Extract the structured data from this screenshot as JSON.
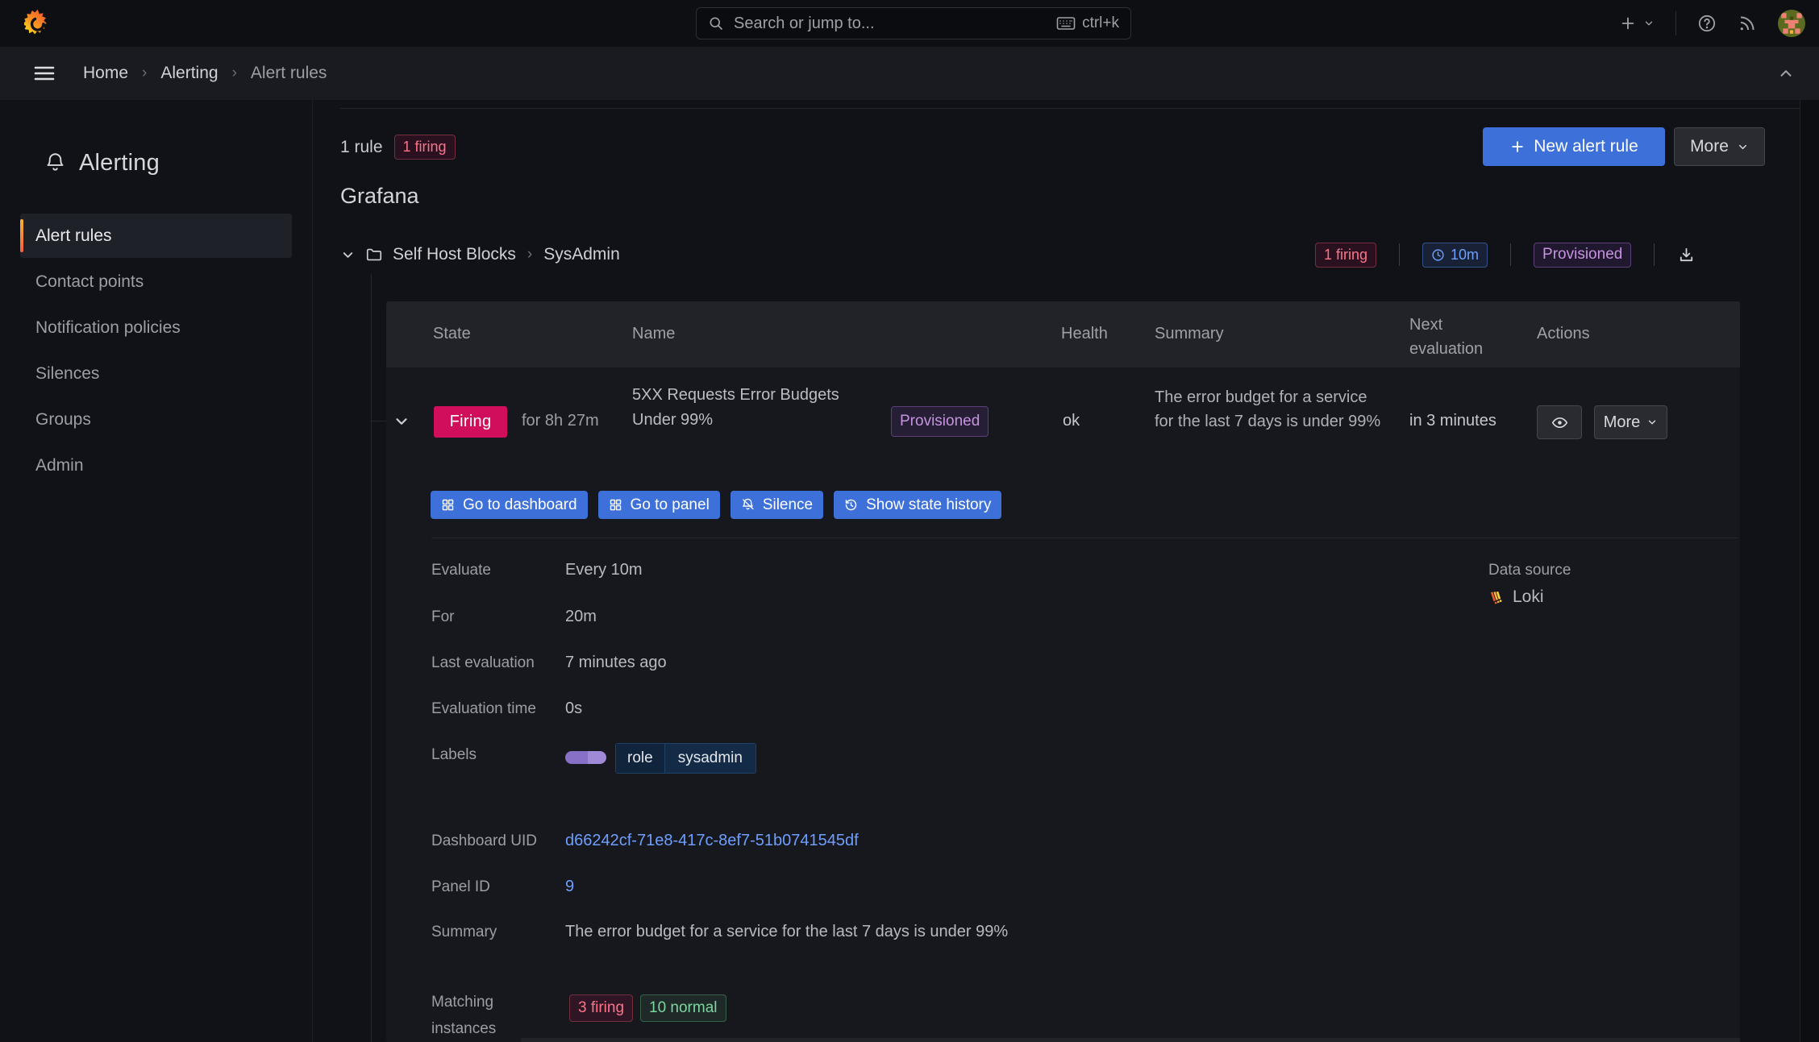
{
  "topnav": {
    "search_placeholder": "Search or jump to...",
    "shortcut": "ctrl+k"
  },
  "breadcrumb": {
    "items": [
      "Home",
      "Alerting",
      "Alert rules"
    ]
  },
  "sidebar": {
    "title": "Alerting",
    "items": [
      {
        "label": "Alert rules",
        "active": true
      },
      {
        "label": "Contact points",
        "active": false
      },
      {
        "label": "Notification policies",
        "active": false
      },
      {
        "label": "Silences",
        "active": false
      },
      {
        "label": "Groups",
        "active": false
      },
      {
        "label": "Admin",
        "active": false
      }
    ]
  },
  "toolbar": {
    "rule_count": "1 rule",
    "firing_badge": "1 firing",
    "new_rule_label": "New alert rule",
    "more_label": "More"
  },
  "section": {
    "namespace": "Grafana"
  },
  "group": {
    "folder": "Self Host Blocks",
    "name": "SysAdmin",
    "firing_badge": "1 firing",
    "interval": "10m",
    "provisioned_label": "Provisioned"
  },
  "table": {
    "headers": {
      "state": "State",
      "name": "Name",
      "health": "Health",
      "summary": "Summary",
      "next_evaluation": "Next evaluation",
      "actions": "Actions"
    },
    "row": {
      "state": "Firing",
      "duration": "for 8h 27m",
      "name": "5XX Requests Error Budgets Under 99%",
      "provisioned_label": "Provisioned",
      "health": "ok",
      "summary": "The error budget for a service for the last 7 days is under 99%",
      "next_evaluation": "in 3 minutes",
      "more_label": "More"
    }
  },
  "row_actions": {
    "dashboard": "Go to dashboard",
    "panel": "Go to panel",
    "silence": "Silence",
    "history": "Show state history"
  },
  "details": {
    "rows": [
      {
        "label": "Evaluate",
        "value": "Every 10m"
      },
      {
        "label": "For",
        "value": "20m"
      },
      {
        "label": "Last evaluation",
        "value": "7 minutes ago"
      },
      {
        "label": "Evaluation time",
        "value": "0s"
      },
      {
        "label": "Labels",
        "value": ""
      }
    ],
    "label_chip": {
      "key": "role",
      "value": "sysadmin"
    },
    "datasource": {
      "label": "Data source",
      "name": "Loki"
    },
    "meta": [
      {
        "label": "Dashboard UID",
        "value": "d66242cf-71e8-417c-8ef7-51b0741545df"
      },
      {
        "label": "Panel ID",
        "value": "9"
      },
      {
        "label": "Summary",
        "value": "The error budget for a service for the last 7 days is under 99%"
      }
    ],
    "matching": {
      "label": "Matching instances",
      "firing": "3 firing",
      "normal": "10 normal"
    }
  },
  "colors": {
    "primary_blue": "#3D71D9",
    "firing_red": "#D10E5C",
    "link_blue": "#6E9FFF",
    "badge_red_text": "#FF7389",
    "badge_green_text": "#7CD6A2",
    "badge_purple_text": "#C793E0",
    "badge_blue_text": "#6E9FFF",
    "accent_orange": "#F55F3E"
  }
}
